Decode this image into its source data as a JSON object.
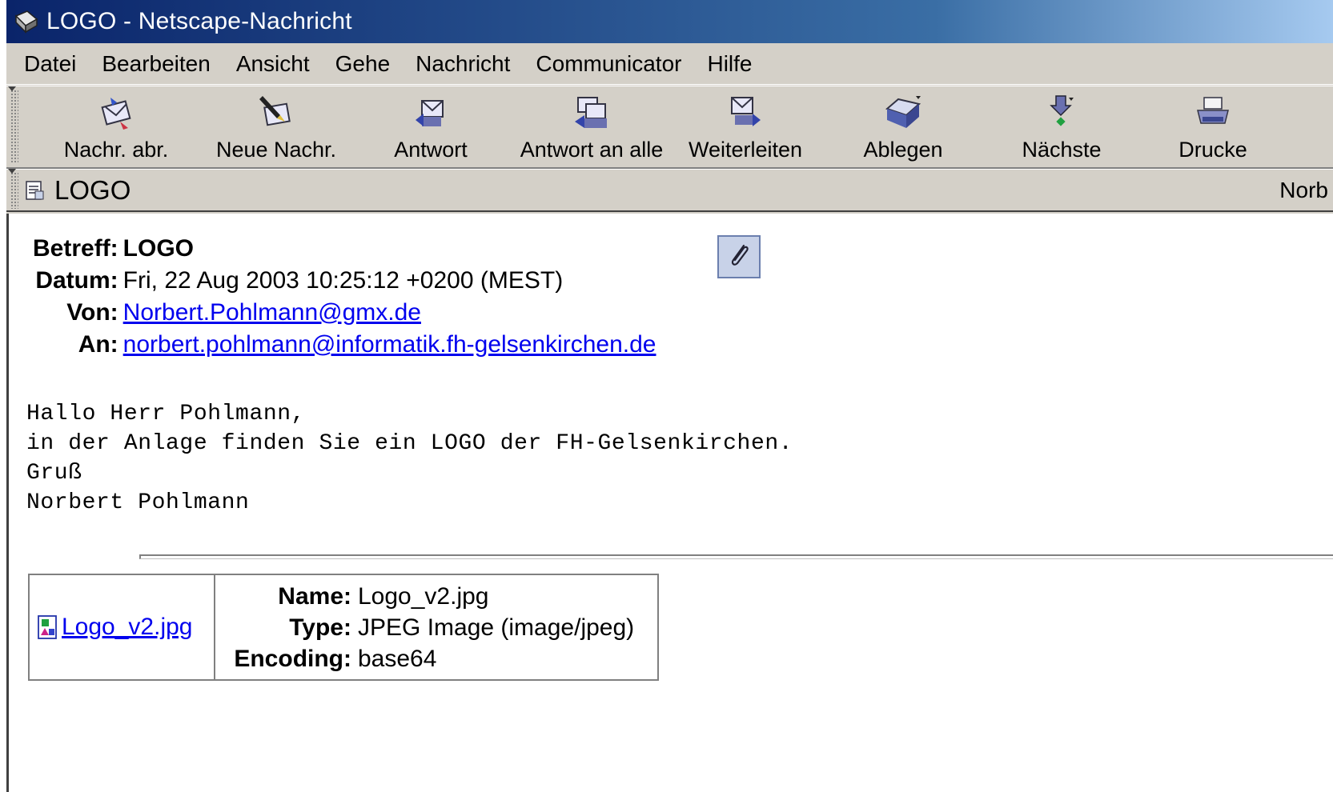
{
  "window": {
    "title": "LOGO - Netscape-Nachricht"
  },
  "menu": [
    {
      "label": "Datei"
    },
    {
      "label": "Bearbeiten"
    },
    {
      "label": "Ansicht"
    },
    {
      "label": "Gehe"
    },
    {
      "label": "Nachricht"
    },
    {
      "label": "Communicator"
    },
    {
      "label": "Hilfe"
    }
  ],
  "toolbar": [
    {
      "label": "Nachr. abr.",
      "icon": "get-messages-icon"
    },
    {
      "label": "Neue Nachr.",
      "icon": "new-message-icon"
    },
    {
      "label": "Antwort",
      "icon": "reply-icon"
    },
    {
      "label": "Antwort an alle",
      "icon": "reply-all-icon"
    },
    {
      "label": "Weiterleiten",
      "icon": "forward-icon"
    },
    {
      "label": "Ablegen",
      "icon": "file-icon"
    },
    {
      "label": "Nächste",
      "icon": "next-icon"
    },
    {
      "label": "Drucke",
      "icon": "print-icon"
    }
  ],
  "subjectbar": {
    "subject": "LOGO",
    "sender_short": "Norb"
  },
  "headers": {
    "subject_label": "Betreff:",
    "subject": "LOGO",
    "date_label": "Datum:",
    "date": "Fri, 22 Aug 2003 10:25:12 +0200 (MEST)",
    "from_label": "Von:",
    "from": "Norbert.Pohlmann@gmx.de",
    "to_label": "An:",
    "to": "norbert.pohlmann@informatik.fh-gelsenkirchen.de"
  },
  "body": {
    "line1": "Hallo Herr Pohlmann,",
    "line2": "in der Anlage finden Sie ein LOGO der FH-Gelsenkirchen.",
    "line3": "Gruß",
    "line4": "Norbert Pohlmann"
  },
  "attachment": {
    "link_text": "Logo_v2.jpg",
    "name_label": "Name:",
    "name": "Logo_v2.jpg",
    "type_label": "Type:",
    "type": "JPEG Image (image/jpeg)",
    "encoding_label": "Encoding:",
    "encoding": "base64"
  },
  "colors": {
    "titlebar_start": "#0a246a",
    "titlebar_end": "#a6caf0",
    "chrome": "#d4d0c8",
    "link": "#0000ee"
  }
}
